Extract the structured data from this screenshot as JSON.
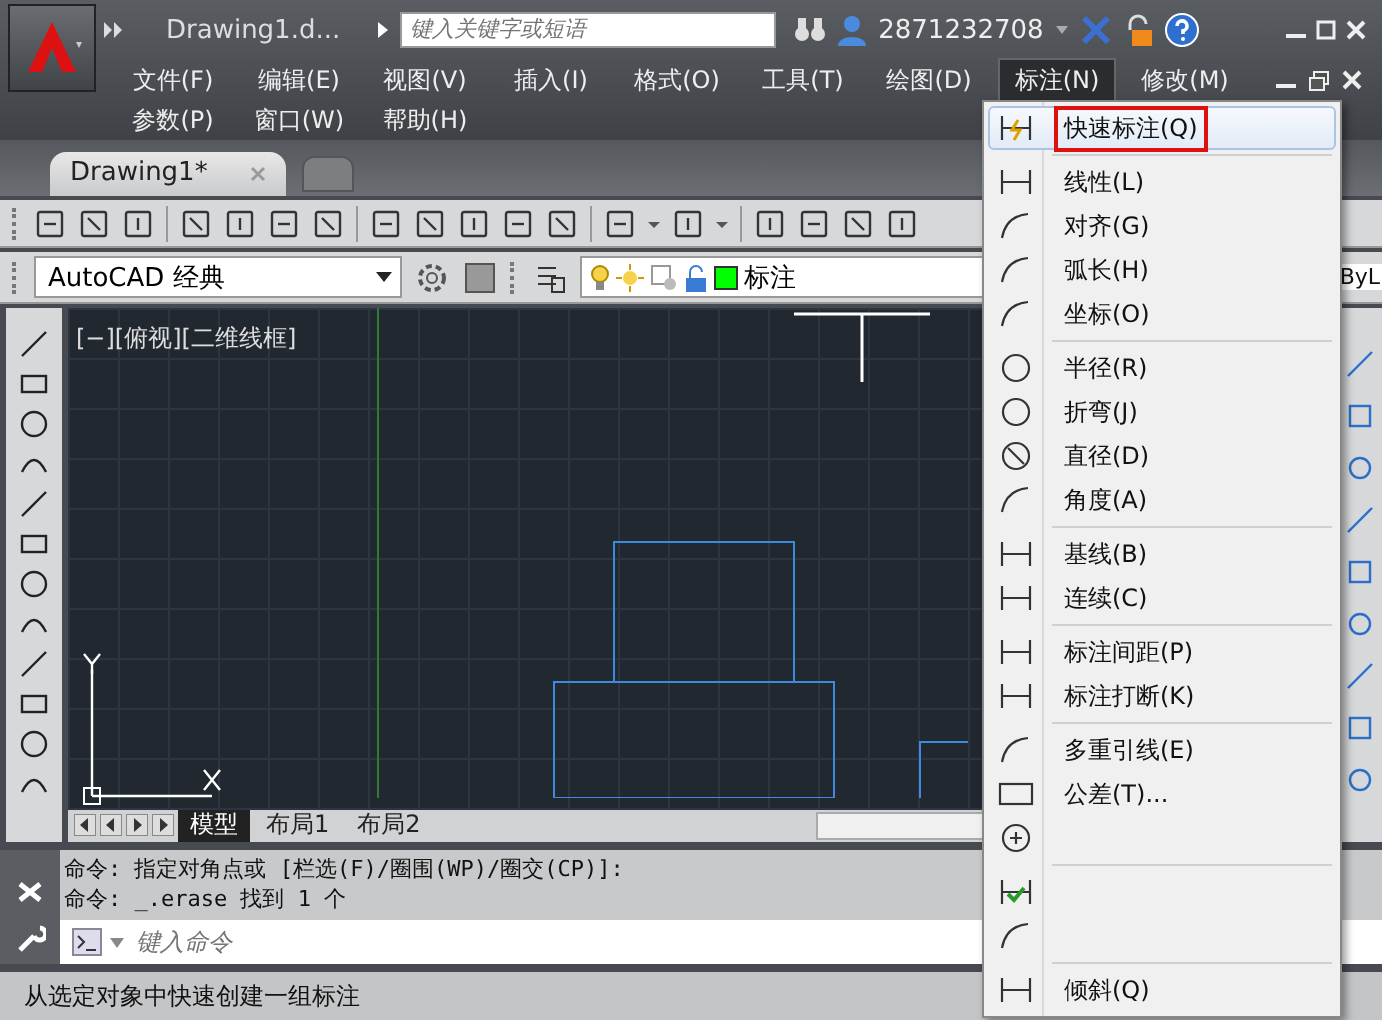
{
  "title_bar": {
    "title": "Drawing1.d...",
    "search": {
      "placeholder": "键入关键字或短语"
    },
    "user": "2871232708"
  },
  "menu_bar": {
    "rows": [
      [
        {
          "label": "文件(F)",
          "selected": false
        },
        {
          "label": "编辑(E)",
          "selected": false
        },
        {
          "label": "视图(V)",
          "selected": false
        },
        {
          "label": "插入(I)",
          "selected": false
        },
        {
          "label": "格式(O)",
          "selected": false
        },
        {
          "label": "工具(T)",
          "selected": false
        },
        {
          "label": "绘图(D)",
          "selected": false
        },
        {
          "label": "标注(N)",
          "selected": true
        },
        {
          "label": "修改(M)",
          "selected": false
        }
      ],
      [
        {
          "label": "参数(P)",
          "selected": false
        },
        {
          "label": "窗口(W)",
          "selected": false
        },
        {
          "label": "帮助(H)",
          "selected": false
        }
      ]
    ]
  },
  "file_tabs": [
    {
      "label": "Drawing1*",
      "selected": true
    }
  ],
  "workspace": {
    "value": "AutoCAD 经典"
  },
  "layer": {
    "name": "标注",
    "color": "#00ff00"
  },
  "property_toolbar": {
    "linetype": "ByL"
  },
  "viewport": {
    "label": "[−][俯视][二维线框]"
  },
  "layout_tabs": [
    {
      "label": "模型",
      "selected": true
    },
    {
      "label": "布局1",
      "selected": false
    },
    {
      "label": "布局2",
      "selected": false
    }
  ],
  "command_history": [
    "命令: 指定对角点或 [栏选(F)/圈围(WP)/圈交(CP)]:",
    "命令: _.erase 找到 1 个"
  ],
  "command_input": {
    "placeholder": "键入命令"
  },
  "status_bar": {
    "text": "从选定对象中快速创建一组标注"
  },
  "dropdown_menu": {
    "groups": [
      [
        {
          "label": "快速标注(Q)",
          "selected": true
        }
      ],
      [
        {
          "label": "线性(L)",
          "selected": false
        },
        {
          "label": "对齐(G)",
          "selected": false
        },
        {
          "label": "弧长(H)",
          "selected": false
        },
        {
          "label": "坐标(O)",
          "selected": false
        }
      ],
      [
        {
          "label": "半径(R)",
          "selected": false
        },
        {
          "label": "折弯(J)",
          "selected": false
        },
        {
          "label": "直径(D)",
          "selected": false
        },
        {
          "label": "角度(A)",
          "selected": false
        }
      ],
      [
        {
          "label": "基线(B)",
          "selected": false
        },
        {
          "label": "连续(C)",
          "selected": false
        }
      ],
      [
        {
          "label": "标注间距(P)",
          "selected": false
        },
        {
          "label": "标注打断(K)",
          "selected": false
        }
      ],
      [
        {
          "label": "多重引线(E)",
          "selected": false
        },
        {
          "label": "公差(T)...",
          "selected": false
        },
        {
          "selected": false
        }
      ],
      [
        {
          "selected": false
        },
        {
          "selected": false
        }
      ],
      [
        {
          "label": "倾斜(Q)",
          "selected": false
        }
      ]
    ]
  }
}
